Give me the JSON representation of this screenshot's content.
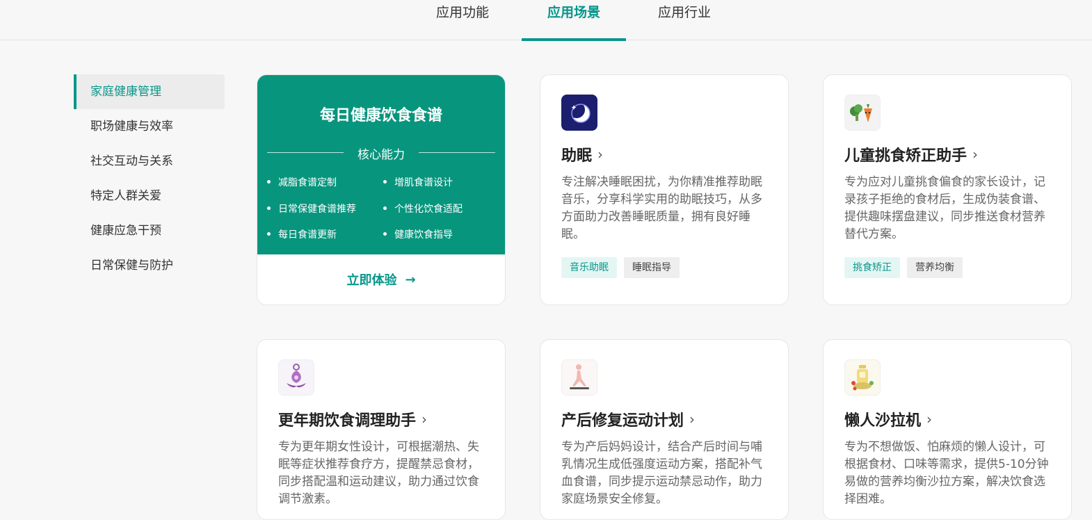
{
  "tabs": [
    {
      "label": "应用功能",
      "active": false
    },
    {
      "label": "应用场景",
      "active": true
    },
    {
      "label": "应用行业",
      "active": false
    }
  ],
  "sidebar": {
    "items": [
      {
        "label": "家庭健康管理",
        "active": true
      },
      {
        "label": "职场健康与效率"
      },
      {
        "label": "社交互动与关系"
      },
      {
        "label": "特定人群关爱"
      },
      {
        "label": "健康应急干预"
      },
      {
        "label": "日常保健与防护"
      }
    ]
  },
  "feature_card": {
    "title": "每日健康饮食食谱",
    "capability_label": "核心能力",
    "capabilities": [
      "减脂食谱定制",
      "增肌食谱设计",
      "日常保健食谱推荐",
      "个性化饮食适配",
      "每日食谱更新",
      "健康饮食指导"
    ],
    "cta_label": "立即体验",
    "accent_color": "#08957e"
  },
  "cards": [
    {
      "title": "助眠",
      "icon": "moon-sleep-icon",
      "description": "专注解决睡眠困扰，为你精准推荐助眠音乐，分享科学实用的助眠技巧，从多方面助力改善睡眠质量，拥有良好睡眠。",
      "tags": [
        "音乐助眠",
        "睡眠指导"
      ]
    },
    {
      "title": "儿童挑食矫正助手",
      "icon": "vegetables-icon",
      "description": "专为应对儿童挑食偏食的家长设计，记录孩子拒绝的食材后，生成伪装食谱、提供趣味摆盘建议，同步推送食材营养替代方案。",
      "tags": [
        "挑食矫正",
        "营养均衡"
      ]
    },
    {
      "title": "更年期饮食调理助手",
      "icon": "lotus-meditation-icon",
      "description": "专为更年期女性设计，可根据潮热、失眠等症状推荐食疗方，提醒禁忌食材，同步搭配温和运动建议，助力通过饮食调节激素。"
    },
    {
      "title": "产后修复运动计划",
      "icon": "yoga-pose-icon",
      "description": "专为产后妈妈设计，结合产后时间与哺乳情况生成低强度运动方案，搭配补气血食谱，同步提示运动禁忌动作，助力家庭场景安全修复。"
    },
    {
      "title": "懒人沙拉机",
      "icon": "salad-machine-icon",
      "description": "专为不想做饭、怕麻烦的懒人设计，可根据食材、口味等需求，提供5-10分钟易做的营养均衡沙拉方案，解决饮食选择困难。"
    }
  ]
}
